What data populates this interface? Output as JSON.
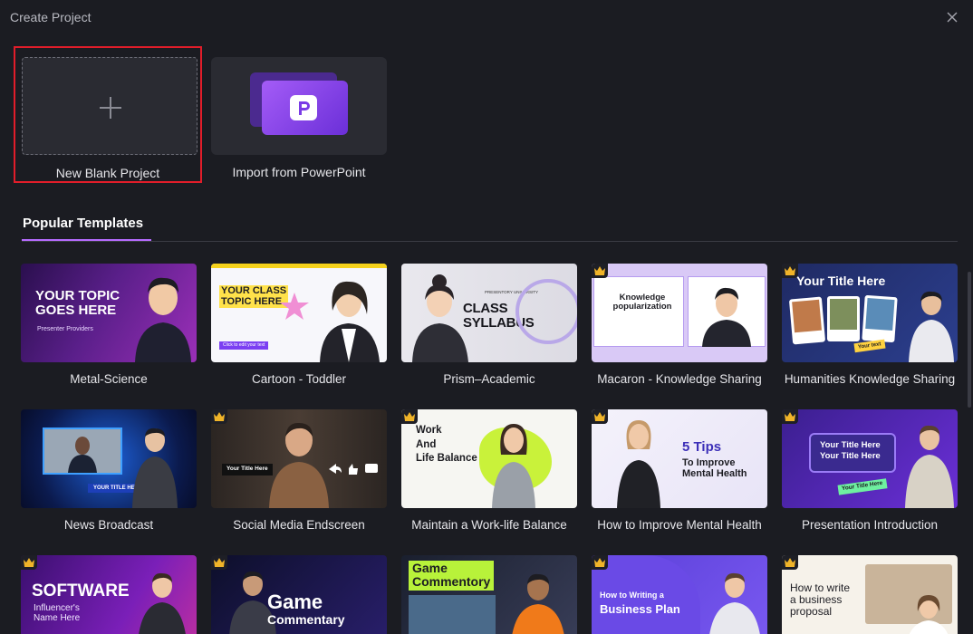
{
  "window": {
    "title": "Create Project"
  },
  "create": {
    "blank_label": "New Blank Project",
    "ppt_label": "Import from PowerPoint"
  },
  "section": {
    "title": "Popular Templates"
  },
  "templates": [
    {
      "label": "Metal-Science",
      "premium": false,
      "text": [
        "YOUR TOPIC",
        "GOES HERE"
      ],
      "sub": "Presenter Providers"
    },
    {
      "label": "Cartoon - Toddler",
      "premium": false,
      "text": [
        "YOUR CLASS",
        "TOPIC HERE"
      ],
      "sub": "Click to edit your text"
    },
    {
      "label": "Prism–Academic",
      "premium": false,
      "text": [
        "CLASS SYLLABUS"
      ],
      "sub": "PRESENTORY UNIVERSITY"
    },
    {
      "label": "Macaron - Knowledge Sharing",
      "premium": true,
      "text": [
        "Knowledge",
        "popularization"
      ]
    },
    {
      "label": "Humanities Knowledge Sharing",
      "premium": true,
      "text": [
        "Your Title Here"
      ],
      "sub": "Your text"
    },
    {
      "label": "News Broadcast",
      "premium": false,
      "text": [
        "YOUR TITLE HERE"
      ]
    },
    {
      "label": "Social Media Endscreen",
      "premium": true,
      "text": [
        "Your Title Here"
      ]
    },
    {
      "label": "Maintain a Work-life Balance",
      "premium": true,
      "text": [
        "Work",
        "And",
        "Life Balance"
      ]
    },
    {
      "label": "How to Improve Mental Health",
      "premium": true,
      "text": [
        "5 Tips",
        "To Improve",
        "Mental Health"
      ]
    },
    {
      "label": "Presentation Introduction",
      "premium": true,
      "text": [
        "Your Title Here",
        "Your Title Here"
      ],
      "sub": "Your Title Here"
    },
    {
      "label": "",
      "premium": true,
      "text": [
        "SOFTWARE",
        "Influencer's",
        "Name Here"
      ]
    },
    {
      "label": "",
      "premium": true,
      "text": [
        "Game",
        "Commentary"
      ]
    },
    {
      "label": "",
      "premium": false,
      "text": [
        "Game",
        "Commentory"
      ]
    },
    {
      "label": "",
      "premium": true,
      "text": [
        "How to Writing a",
        "Business Plan"
      ]
    },
    {
      "label": "",
      "premium": true,
      "text": [
        "How to write",
        "a business",
        "proposal"
      ]
    }
  ],
  "colors": {
    "accent": "#b66bff",
    "selection": "#e11d2a",
    "background": "#1b1c22",
    "crown": "#f0b429"
  }
}
